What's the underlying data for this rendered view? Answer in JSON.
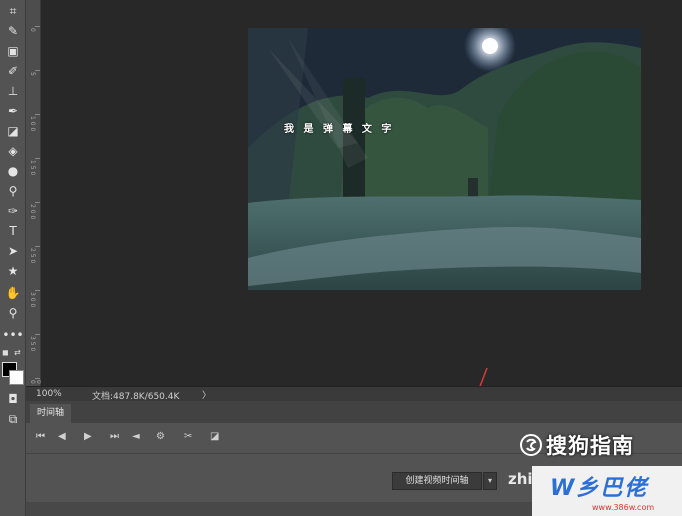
{
  "toolbar": {
    "tools": [
      {
        "name": "crop-icon",
        "glyph": "⌗"
      },
      {
        "name": "eyedropper-icon",
        "glyph": "✎"
      },
      {
        "name": "marquee-icon",
        "glyph": "▣"
      },
      {
        "name": "brush-icon",
        "glyph": "✐"
      },
      {
        "name": "stamp-icon",
        "glyph": "⊥"
      },
      {
        "name": "history-brush-icon",
        "glyph": "✒"
      },
      {
        "name": "eraser-icon",
        "glyph": "◪"
      },
      {
        "name": "paint-bucket-icon",
        "glyph": "◈"
      },
      {
        "name": "blur-icon",
        "glyph": "●"
      },
      {
        "name": "dodge-icon",
        "glyph": "⚲"
      },
      {
        "name": "pen-icon",
        "glyph": "✑"
      },
      {
        "name": "type-icon",
        "glyph": "T"
      },
      {
        "name": "path-selection-icon",
        "glyph": "➤"
      },
      {
        "name": "shape-icon",
        "glyph": "★"
      },
      {
        "name": "hand-icon",
        "glyph": "✋"
      },
      {
        "name": "zoom-icon",
        "glyph": "⚲"
      },
      {
        "name": "more-tools-icon",
        "glyph": "•••"
      }
    ],
    "quick_mask_glyph": "◘",
    "screen_mode_glyph": "⧉"
  },
  "ruler": {
    "labels": [
      "0",
      "5",
      "1 0 0",
      "1 5 0",
      "2 0 0",
      "2 5 0",
      "3 0 0",
      "3 5 0",
      "4 0 0"
    ]
  },
  "document": {
    "overlay_text": "我 是 弹 幕 文 字"
  },
  "statusbar": {
    "zoom": "100%",
    "doc_size": "文档:487.8K/650.4K",
    "arrow": "〉"
  },
  "timeline": {
    "tab_label": "时间轴",
    "controls": [
      "⏮",
      "◀",
      "▶",
      "⏭",
      "◄",
      "⚙",
      "✂",
      "◪"
    ],
    "create_button_label": "创建视频时间轴",
    "dropdown_glyph": "▾"
  },
  "watermarks": {
    "sogou_text": "搜狗指南",
    "zhi_text": "zhi",
    "site_main": "W乡巴佬",
    "site_url": "www.386w.com"
  },
  "colors": {
    "toolbar_bg": "#535353",
    "canvas_bg": "#282828",
    "arrow": "#d43b3b"
  }
}
